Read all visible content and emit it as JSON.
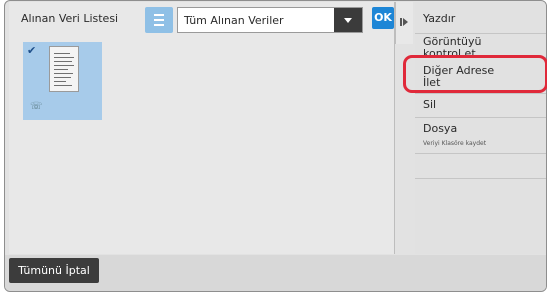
{
  "list": {
    "title": "Alınan Veri Listesi",
    "filter_value": "Tüm Alınan Veriler",
    "ok_label": "OK"
  },
  "menu": {
    "items": [
      {
        "label": "Yazdır",
        "sub": ""
      },
      {
        "label": "Görüntüyü\nkontrol et",
        "sub": ""
      },
      {
        "label": "Diğer Adrese\nİlet",
        "sub": ""
      },
      {
        "label": "Sil",
        "sub": ""
      },
      {
        "label": "Dosya",
        "sub": "Veriyi Klasöre kaydet"
      }
    ]
  },
  "footer": {
    "cancel_all_label": "Tümünü İptal"
  },
  "icons": [
    "list-view-icon",
    "dropdown-arrow-icon",
    "checkmark-icon",
    "fax-received-icon",
    "collapse-panel-icon"
  ],
  "colors": {
    "accent": "#1e86d6",
    "selection": "#a7cbea",
    "highlight": "#e0293a"
  }
}
